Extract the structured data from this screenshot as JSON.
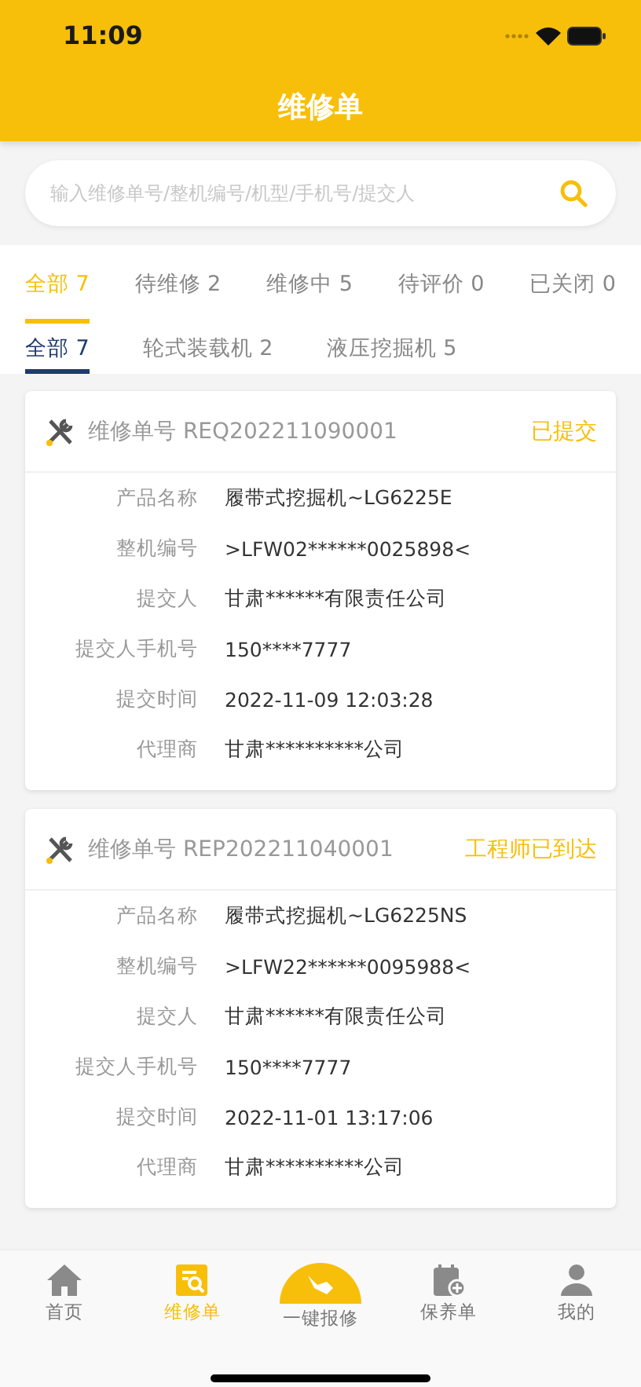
{
  "status_bar": {
    "time": "11:09"
  },
  "header": {
    "title": "维修单"
  },
  "search": {
    "placeholder": "输入维修单号/整机编号/机型/手机号/提交人"
  },
  "status_tabs": [
    {
      "label": "全部 7",
      "selected": true
    },
    {
      "label": "待维修 2",
      "selected": false
    },
    {
      "label": "维修中 5",
      "selected": false
    },
    {
      "label": "待评价 0",
      "selected": false
    },
    {
      "label": "已关闭 0",
      "selected": false
    }
  ],
  "type_tabs": [
    {
      "label": "全部 7",
      "selected": true
    },
    {
      "label": "轮式装载机 2",
      "selected": false
    },
    {
      "label": "液压挖掘机 5",
      "selected": false
    }
  ],
  "orders": [
    {
      "number": "维修单号 REQ202211090001",
      "status": "已提交",
      "fields": [
        {
          "label": "产品名称",
          "value": "履带式挖掘机~LG6225E"
        },
        {
          "label": "整机编号",
          "value": ">LFW02******0025898<"
        },
        {
          "label": "提交人",
          "value": "甘肃******有限责任公司"
        },
        {
          "label": "提交人手机号",
          "value": "150****7777"
        },
        {
          "label": "提交时间",
          "value": "2022-11-09 12:03:28"
        },
        {
          "label": "代理商",
          "value": "甘肃**********公司"
        }
      ]
    },
    {
      "number": "维修单号 REP202211040001",
      "status": "工程师已到达",
      "fields": [
        {
          "label": "产品名称",
          "value": "履带式挖掘机~LG6225NS"
        },
        {
          "label": "整机编号",
          "value": ">LFW22******0095988<"
        },
        {
          "label": "提交人",
          "value": "甘肃******有限责任公司"
        },
        {
          "label": "提交人手机号",
          "value": "150****7777"
        },
        {
          "label": "提交时间",
          "value": "2022-11-01 13:17:06"
        },
        {
          "label": "代理商",
          "value": "甘肃**********公司"
        }
      ]
    }
  ],
  "tab_bar": [
    {
      "kind": "home",
      "label": "首页",
      "selected": false
    },
    {
      "kind": "orders",
      "label": "维修单",
      "selected": true
    },
    {
      "kind": "report",
      "label": "一键报修",
      "selected": false
    },
    {
      "kind": "maintenance",
      "label": "保养单",
      "selected": false
    },
    {
      "kind": "profile",
      "label": "我的",
      "selected": false
    }
  ]
}
